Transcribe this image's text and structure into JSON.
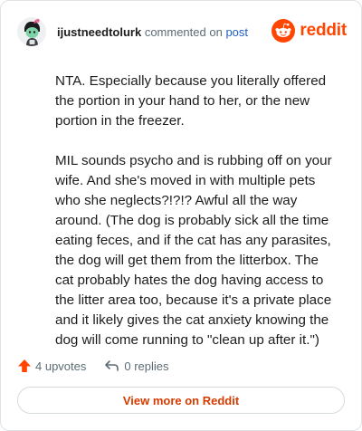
{
  "header": {
    "username": "ijustneedtolurk",
    "commented_on": "commented on",
    "post_link": "post",
    "logo_text": "reddit"
  },
  "comment": {
    "paragraphs": [
      "NTA. Especially because you literally offered the portion in your hand to her, or the new portion in the freezer.",
      "MIL sounds psycho and is rubbing off on your wife. And she's moved in with multiple pets who she neglects?!?!? Awful all the way around. (The dog is probably sick all the time eating feces, and if the cat has any parasites, the dog will get them from the litterbox. The cat probably hates the dog having access to the litter area too, because it's a private place and it likely gives the cat anxiety knowing the dog will come running to \"clean up after it.\")"
    ]
  },
  "actions": {
    "upvotes": "4 upvotes",
    "replies": "0 replies"
  },
  "footer": {
    "view_more": "View more on Reddit"
  },
  "icons": {
    "avatar": "snoo-avatar-icon",
    "logo": "reddit-logo-icon",
    "upvote": "upvote-arrow-icon",
    "reply": "reply-arrow-icon"
  },
  "colors": {
    "brand": "#ff4500",
    "link": "#1d5ec9",
    "view_more": "#d93a00",
    "muted": "#5c6c74"
  }
}
